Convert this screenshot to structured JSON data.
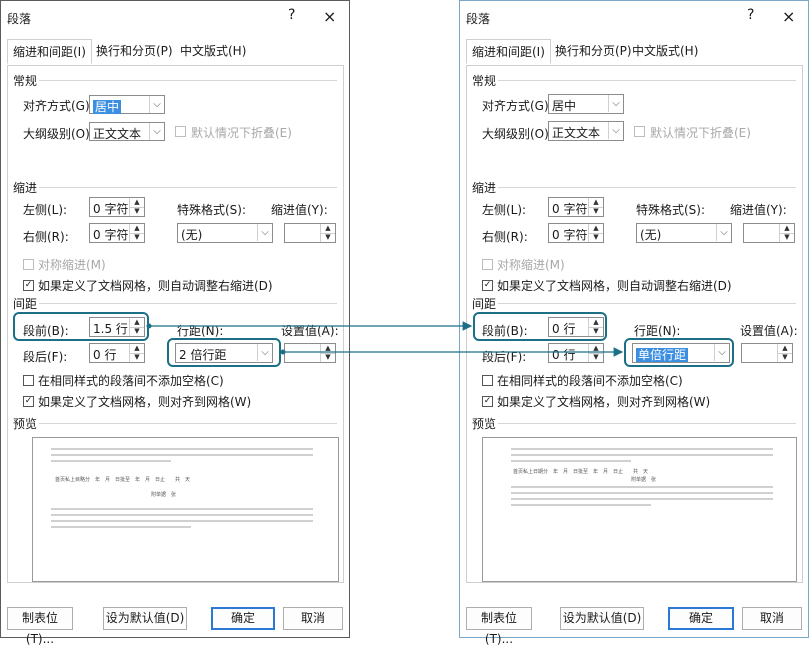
{
  "left": {
    "title": "段落",
    "help": "?",
    "close": "×",
    "tabs": [
      "缩进和间距(I)",
      "换行和分页(P)",
      "中文版式(H)"
    ],
    "general_label": "常规",
    "align_label": "对齐方式(G):",
    "align_value": "居中",
    "outline_label": "大纲级别(O):",
    "outline_value": "正文文本",
    "collapse_label": "默认情况下折叠(E)",
    "indent_label": "缩进",
    "left_label": "左侧(L):",
    "left_value": "0 字符",
    "right_label": "右侧(R):",
    "right_value": "0 字符",
    "special_label": "特殊格式(S):",
    "special_value": "(无)",
    "indent_by_label": "缩进值(Y):",
    "mirror_label": "对称缩进(M)",
    "auto_indent_label": "如果定义了文档网格，则自动调整右缩进(D)",
    "spacing_label": "间距",
    "before_label": "段前(B):",
    "before_value": "1.5 行",
    "after_label": "段后(F):",
    "after_value": "0 行",
    "line_spacing_label": "行距(N):",
    "line_spacing_value": "2 倍行距",
    "at_label": "设置值(A):",
    "no_space_label": "在相同样式的段落间不添加空格(C)",
    "snap_grid_label": "如果定义了文档网格，则对齐到网格(W)",
    "preview_label": "预览",
    "preview_sample": "首页私上目略分　年　月　日批至　年　月　日止　　共　天",
    "preview_sample2": "附单据　张",
    "tabs_button": "制表位(T)...",
    "default_button": "设为默认值(D)",
    "ok_button": "确定",
    "cancel_button": "取消"
  },
  "right": {
    "title": "段落",
    "help": "?",
    "close": "×",
    "tabs": [
      "缩进和间距(I)",
      "换行和分页(P)",
      "中文版式(H)"
    ],
    "general_label": "常规",
    "align_label": "对齐方式(G):",
    "align_value": "居中",
    "outline_label": "大纲级别(O):",
    "outline_value": "正文文本",
    "collapse_label": "默认情况下折叠(E)",
    "indent_label": "缩进",
    "left_label": "左侧(L):",
    "left_value": "0 字符",
    "right_label": "右侧(R):",
    "right_value": "0 字符",
    "special_label": "特殊格式(S):",
    "special_value": "(无)",
    "indent_by_label": "缩进值(Y):",
    "mirror_label": "对称缩进(M)",
    "auto_indent_label": "如果定义了文档网格，则自动调整右缩进(D)",
    "spacing_label": "间距",
    "before_label": "段前(B):",
    "before_value": "0 行",
    "after_label": "段后(F):",
    "after_value": "0 行",
    "line_spacing_label": "行距(N):",
    "line_spacing_value": "单倍行距",
    "at_label": "设置值(A):",
    "no_space_label": "在相同样式的段落间不添加空格(C)",
    "snap_grid_label": "如果定义了文档网格，则对齐到网格(W)",
    "preview_label": "预览",
    "preview_sample": "首页私上日期分　年　月　日批至　年　月　日止　　共　天",
    "preview_sample2": "附单据　张",
    "tabs_button": "制表位(T)...",
    "default_button": "设为默认值(D)",
    "ok_button": "确定",
    "cancel_button": "取消"
  },
  "colors": {
    "callout": "#1b6f86",
    "highlight": "#3b8ee0",
    "ok_border": "#2b79d4"
  }
}
